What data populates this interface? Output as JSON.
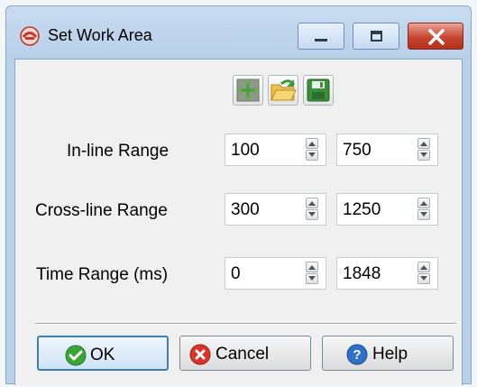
{
  "window": {
    "title": "Set Work Area"
  },
  "toolbar": {
    "icons": [
      "reset-area-icon",
      "open-folder-icon",
      "save-icon"
    ]
  },
  "fields": {
    "inline": {
      "label": "In-line Range",
      "from": "100",
      "to": "750"
    },
    "crossline": {
      "label": "Cross-line Range",
      "from": "300",
      "to": "1250"
    },
    "time": {
      "label": "Time Range (ms)",
      "from": "0",
      "to": "1848"
    }
  },
  "buttons": {
    "ok": "OK",
    "cancel": "Cancel",
    "help": "Help"
  },
  "colors": {
    "ok_green": "#3aa537",
    "cancel_red": "#d9342b",
    "help_blue": "#2f6fc7",
    "titlebar": "#c4d8ee",
    "client": "#f0f0f0"
  }
}
